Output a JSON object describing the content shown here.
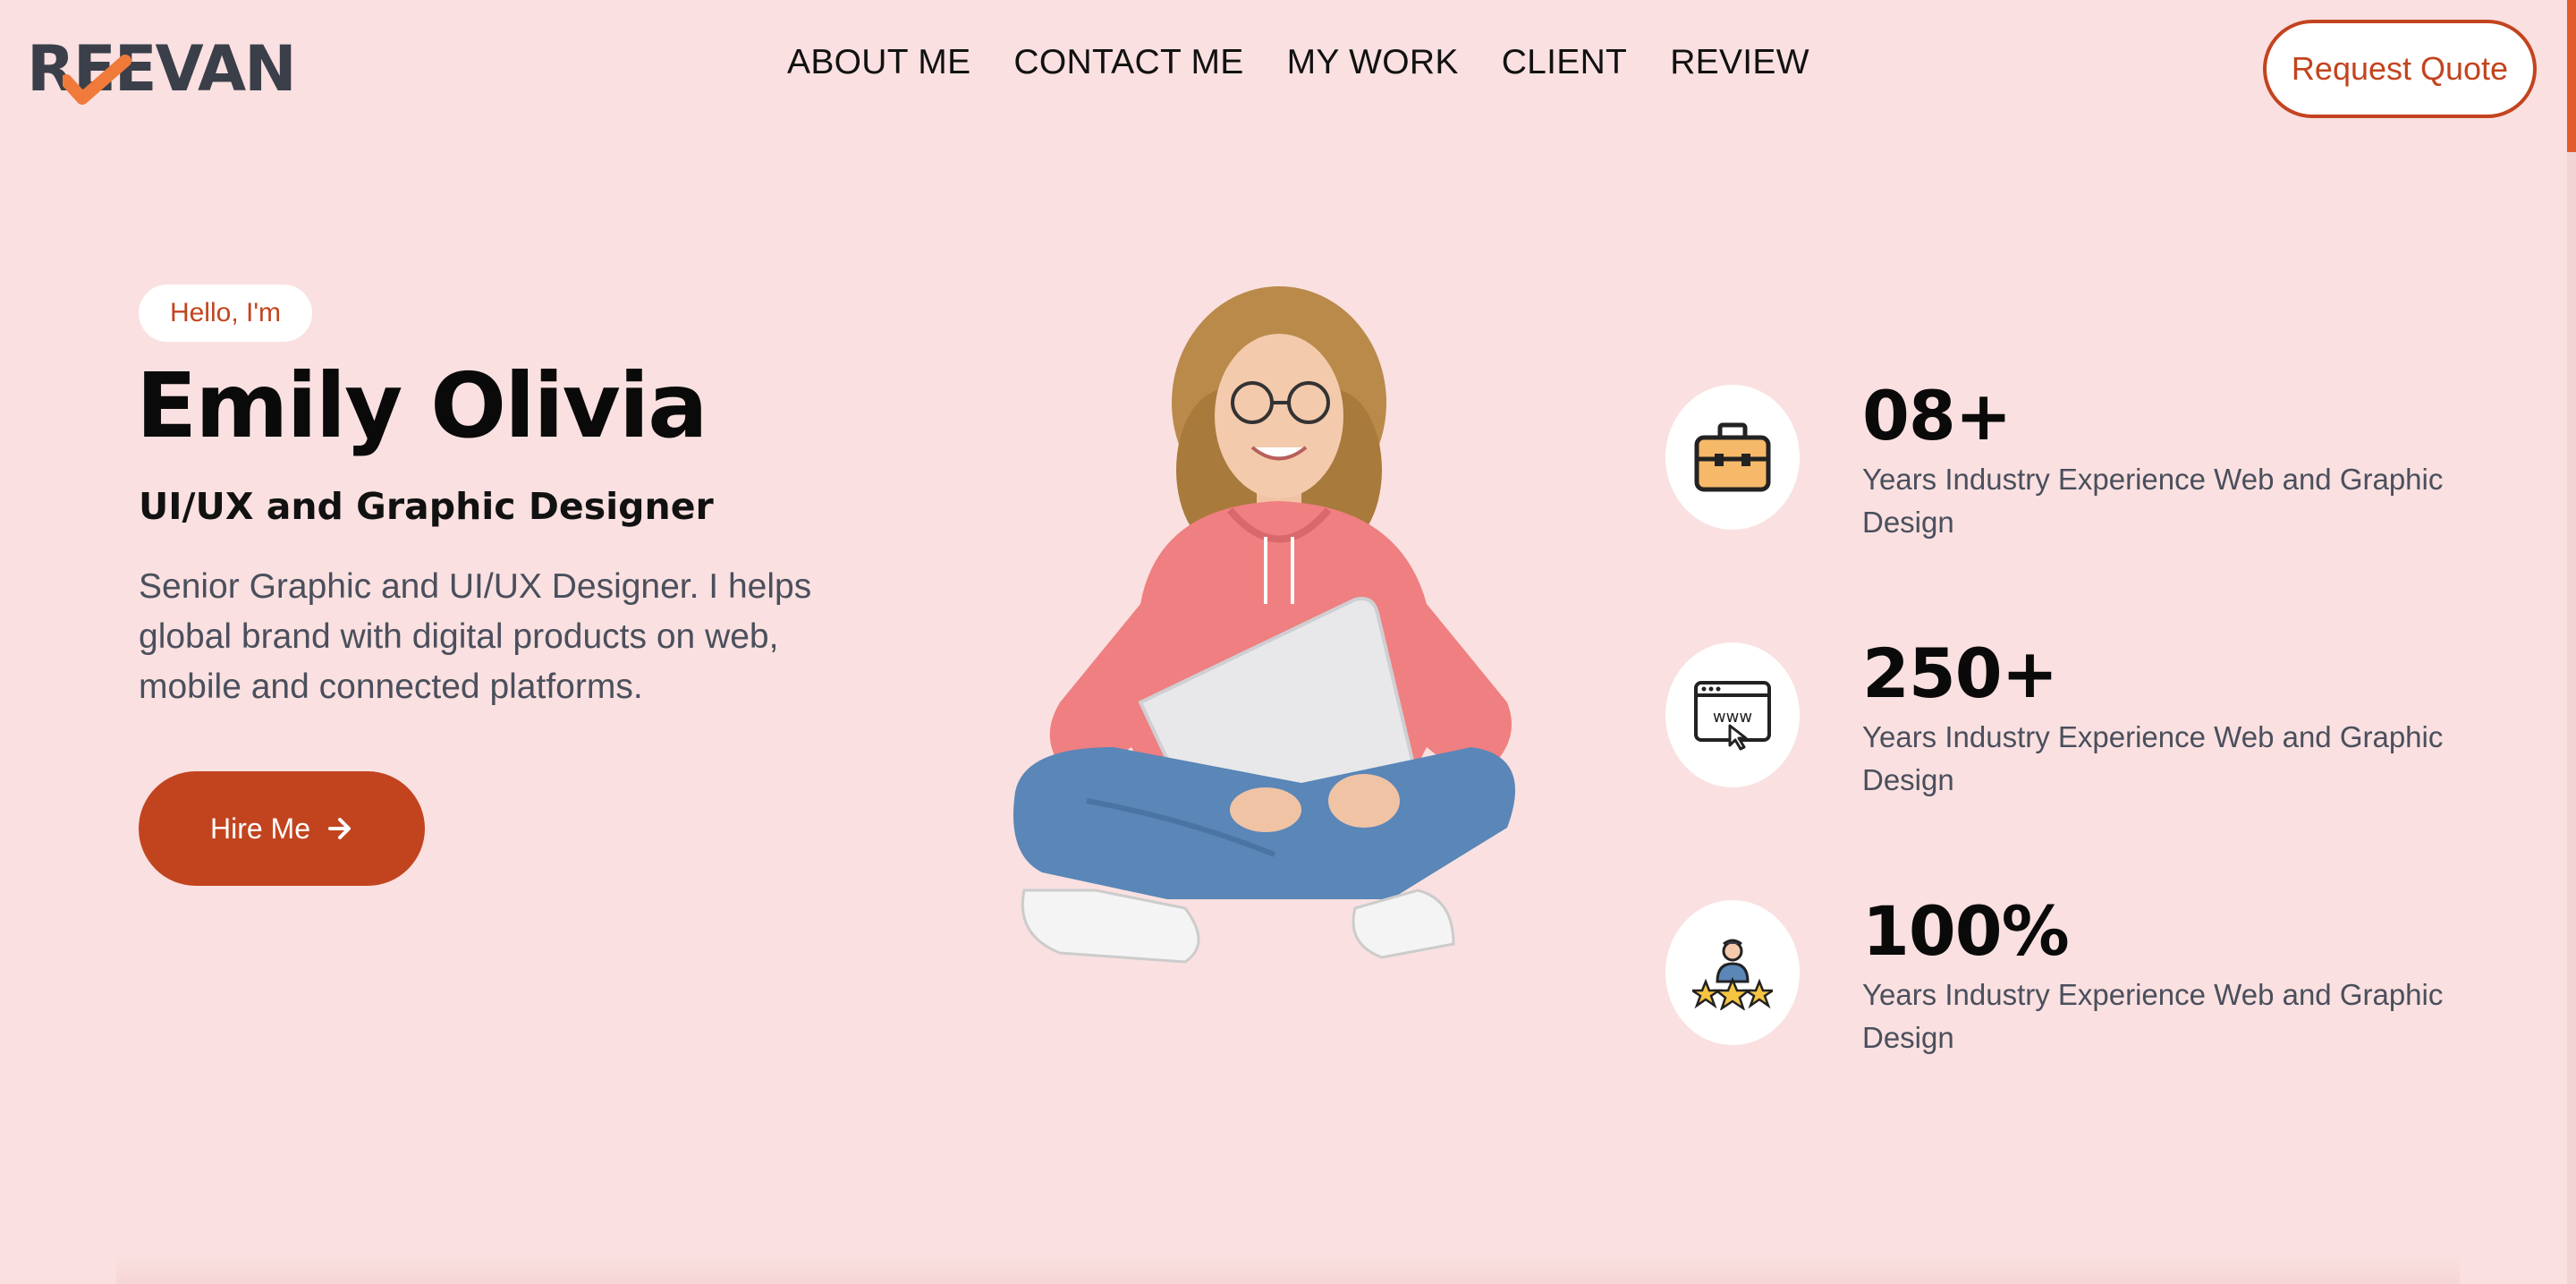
{
  "header": {
    "logo_text": "REEVAN",
    "nav": [
      {
        "label": "ABOUT ME"
      },
      {
        "label": "CONTACT ME"
      },
      {
        "label": "MY WORK"
      },
      {
        "label": "CLIENT"
      },
      {
        "label": "REVIEW"
      }
    ],
    "quote_button": "Request Quote"
  },
  "hero": {
    "greeting": "Hello, I'm",
    "name": "Emily Olivia",
    "role": "UI/UX and Graphic Designer",
    "description": "Senior Graphic and UI/UX Designer. I helps global brand with digital products on web, mobile and connected platforms.",
    "hire_button": "Hire Me"
  },
  "stats": [
    {
      "value": "08+",
      "label": "Years Industry Experience Web and Graphic Design",
      "icon": "briefcase-icon"
    },
    {
      "value": "250+",
      "label": "Years Industry Experience Web and Graphic Design",
      "icon": "www-browser-icon"
    },
    {
      "value": "100%",
      "label": "Years Industry Experience Web and Graphic Design",
      "icon": "rating-person-icon"
    }
  ],
  "colors": {
    "background": "#fae0e0",
    "accent": "#c2441f",
    "logo": "#3a3f4a",
    "check": "#f07a3a"
  }
}
